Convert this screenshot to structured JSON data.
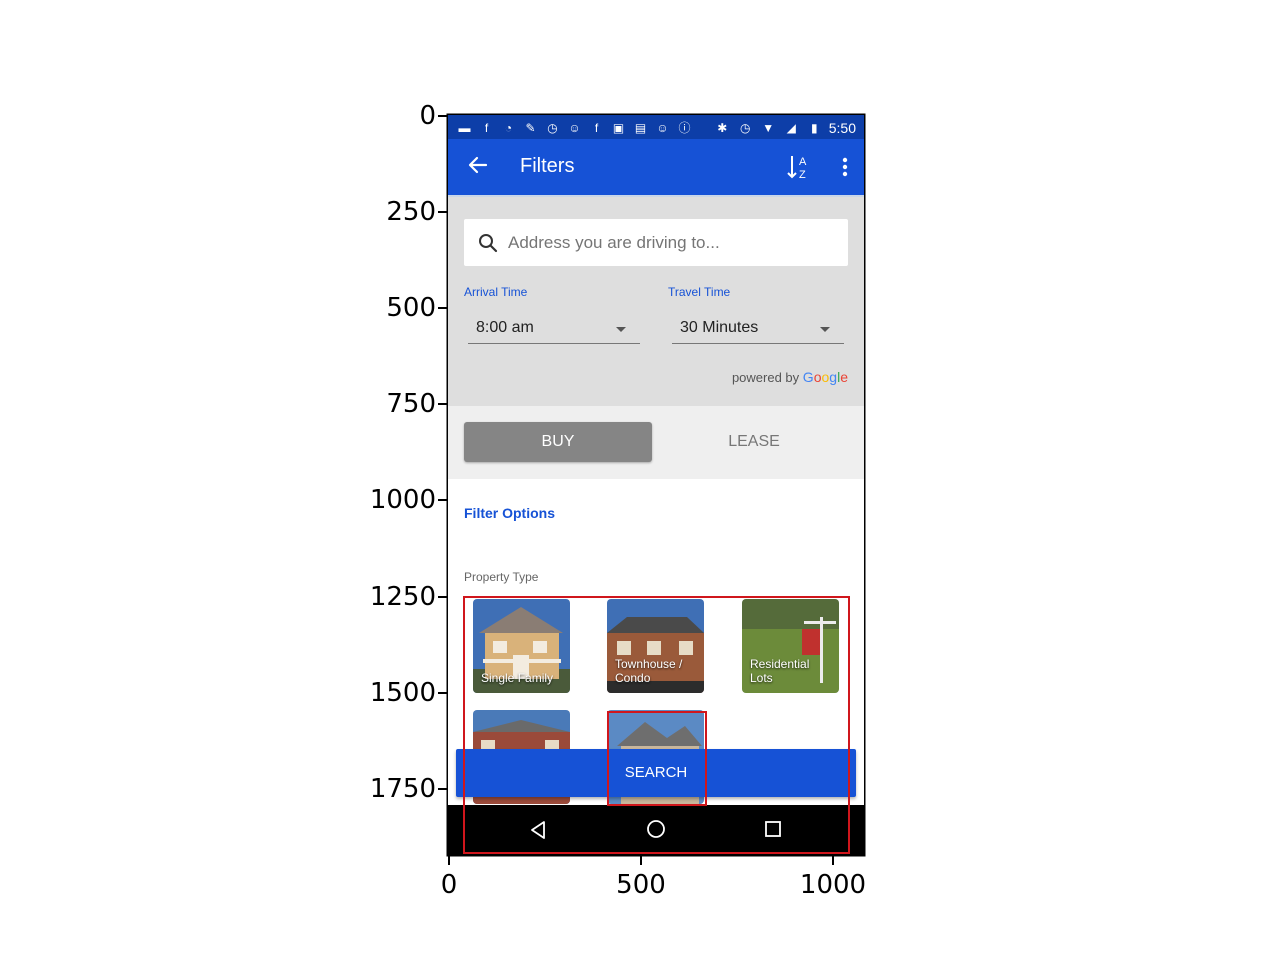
{
  "axes": {
    "y_ticks": [
      "0",
      "250",
      "500",
      "750",
      "1000",
      "1250",
      "1500",
      "1750"
    ],
    "x_ticks": [
      "0",
      "500",
      "1000"
    ]
  },
  "status_bar": {
    "time": "5:50",
    "icons": [
      "message-icon",
      "facebook-icon",
      "timer-icon",
      "wrench-icon",
      "alarm-icon",
      "emoji-icon",
      "facebook-icon",
      "qt-icon",
      "news-icon",
      "emoji-icon",
      "info-icon",
      "bluetooth-icon",
      "alarm-icon",
      "wifi-icon",
      "signal-icon",
      "battery-icon"
    ]
  },
  "app_bar": {
    "title": "Filters",
    "sort_icon_text": "A Z"
  },
  "search": {
    "placeholder": "Address you are driving to..."
  },
  "arrival": {
    "label": "Arrival Time",
    "value": "8:00 am"
  },
  "travel": {
    "label": "Travel Time",
    "value": "30 Minutes"
  },
  "powered_by": {
    "prefix": "powered by",
    "brand_letters": [
      "G",
      "o",
      "o",
      "g",
      "l",
      "e"
    ]
  },
  "mode": {
    "buy": "BUY",
    "lease": "LEASE",
    "selected": "BUY"
  },
  "filters": {
    "heading": "Filter Options",
    "property_type_label": "Property Type",
    "tiles": [
      {
        "label": "Single Family"
      },
      {
        "label": "Townhouse /\nCondo"
      },
      {
        "label": "Residential\nLots"
      },
      {
        "label": ""
      },
      {
        "label": ""
      }
    ]
  },
  "search_button": "SEARCH",
  "colors": {
    "status_bar": "#0d3ea8",
    "app_bar": "#1652d6",
    "accent": "#1652d6",
    "annotation": "#d0161c"
  }
}
